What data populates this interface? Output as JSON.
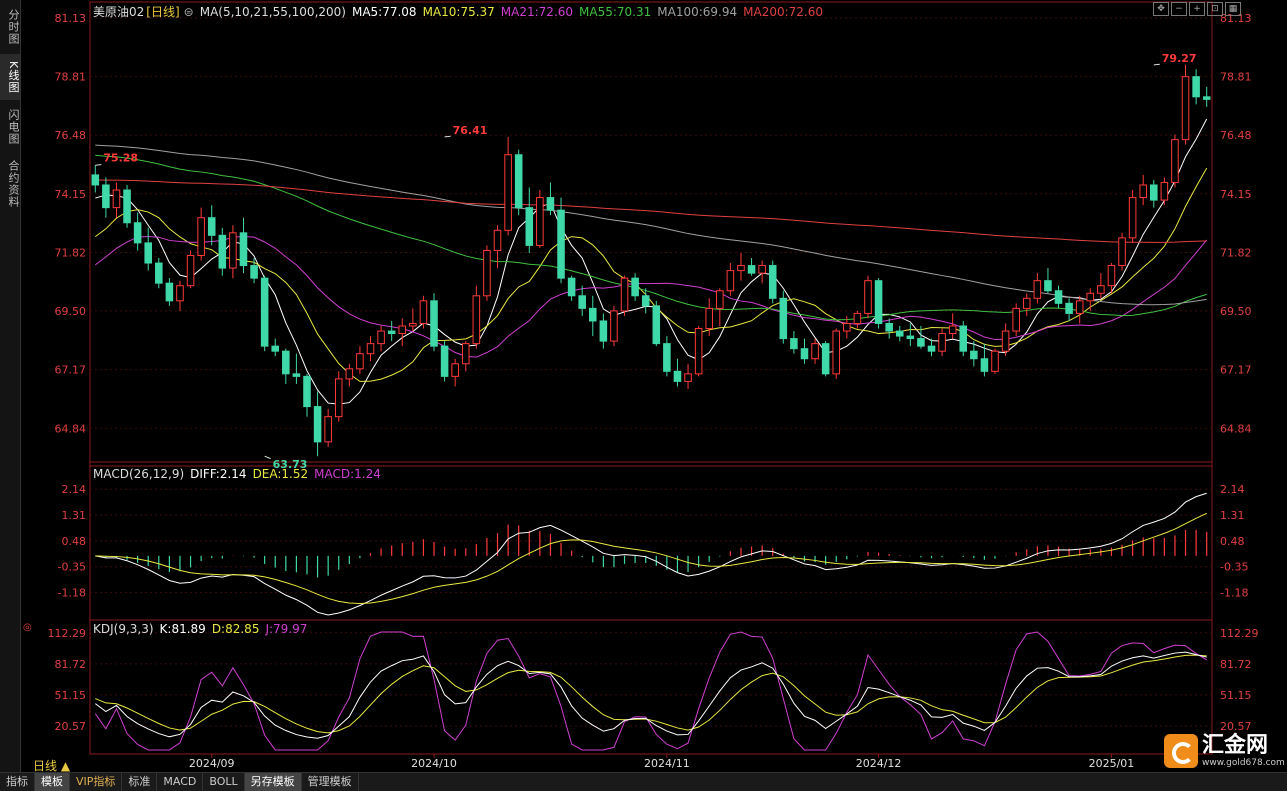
{
  "sidebar": {
    "tabs": [
      "分时图",
      "K线图",
      "闪电图",
      "合约资料"
    ],
    "active": 1
  },
  "header": {
    "symbol": "美原油02",
    "period": "[日线]",
    "ma_label": "MA(5,10,21,55,100,200)",
    "ma": [
      {
        "t": "MA5:77.08",
        "c": "#ffffff"
      },
      {
        "t": "MA10:75.37",
        "c": "#e8e840"
      },
      {
        "t": "MA21:72.60",
        "c": "#d040d0"
      },
      {
        "t": "MA55:70.31",
        "c": "#40c040"
      },
      {
        "t": "MA100:69.94",
        "c": "#a0a0a0"
      },
      {
        "t": "MA200:72.60",
        "c": "#e04040"
      }
    ]
  },
  "macd_header": [
    {
      "t": "MACD(26,12,9)",
      "c": "#dddddd"
    },
    {
      "t": "DIFF:2.14",
      "c": "#ffffff"
    },
    {
      "t": "DEA:1.52",
      "c": "#e8e840"
    },
    {
      "t": "MACD:1.24",
      "c": "#d040d0"
    }
  ],
  "kdj_header": [
    {
      "t": "KDJ(9,3,3)",
      "c": "#dddddd"
    },
    {
      "t": "K:81.89",
      "c": "#ffffff"
    },
    {
      "t": "D:82.85",
      "c": "#e8e840"
    },
    {
      "t": "J:79.97",
      "c": "#d040d0"
    }
  ],
  "price_ticks": [
    "81.13",
    "78.81",
    "76.48",
    "74.15",
    "71.82",
    "69.50",
    "67.17",
    "64.84"
  ],
  "macd_ticks": [
    "2.14",
    "1.31",
    "0.48",
    "-0.35",
    "-1.18"
  ],
  "kdj_ticks": [
    "112.29",
    "81.72",
    "51.15",
    "20.57"
  ],
  "date_labels": [
    {
      "t": "2024/09",
      "i": 11
    },
    {
      "t": "2024/10",
      "i": 32
    },
    {
      "t": "2024/11",
      "i": 54
    },
    {
      "t": "2024/12",
      "i": 74
    },
    {
      "t": "2025/01",
      "i": 96
    }
  ],
  "annotations": {
    "high": "79.27",
    "high_i": 100,
    "high_prev": "76.41",
    "high_prev_i": 33,
    "start": "75.28",
    "start_i": 0,
    "low": "63.73",
    "low_i": 16
  },
  "period_label": "日线",
  "tabs": [
    "指标",
    "模板",
    "VIP指标",
    "标准",
    "MACD",
    "BOLL",
    "另存模板",
    "管理模板"
  ],
  "tab_selected": [
    1,
    6
  ],
  "toolbar_icons": [
    "move-icon",
    "zoom-out-icon",
    "zoom-in-icon",
    "zoom-fit-icon",
    "chart-icon"
  ],
  "logo": {
    "text": "汇金网",
    "url": "www.gold678.com"
  },
  "chart_data": {
    "type": "candlestick",
    "ylim": [
      63.5,
      81.13
    ],
    "ohlc": [
      [
        74.9,
        75.28,
        74.2,
        74.5
      ],
      [
        74.5,
        74.8,
        73.2,
        73.6
      ],
      [
        73.6,
        74.6,
        73.2,
        74.3
      ],
      [
        74.3,
        74.5,
        72.8,
        73.0
      ],
      [
        73.0,
        73.4,
        71.9,
        72.2
      ],
      [
        72.2,
        72.8,
        71.1,
        71.4
      ],
      [
        71.4,
        71.6,
        70.4,
        70.6
      ],
      [
        70.6,
        70.8,
        69.7,
        69.9
      ],
      [
        69.9,
        70.7,
        69.5,
        70.5
      ],
      [
        70.5,
        71.9,
        70.4,
        71.7
      ],
      [
        71.7,
        73.6,
        71.5,
        73.2
      ],
      [
        73.2,
        73.7,
        72.1,
        72.5
      ],
      [
        72.5,
        72.8,
        70.9,
        71.2
      ],
      [
        71.2,
        72.9,
        70.8,
        72.6
      ],
      [
        72.6,
        73.2,
        71.0,
        71.3
      ],
      [
        71.3,
        71.6,
        70.6,
        70.8
      ],
      [
        70.8,
        70.9,
        67.9,
        68.1
      ],
      [
        68.1,
        68.4,
        67.7,
        67.9
      ],
      [
        67.9,
        68.0,
        66.6,
        67.0
      ],
      [
        67.0,
        67.8,
        66.6,
        66.9
      ],
      [
        66.9,
        67.0,
        65.3,
        65.7
      ],
      [
        65.7,
        66.3,
        63.73,
        64.3
      ],
      [
        64.3,
        65.6,
        64.1,
        65.3
      ],
      [
        65.3,
        67.1,
        65.1,
        66.8
      ],
      [
        66.8,
        67.4,
        66.5,
        67.2
      ],
      [
        67.2,
        68.1,
        67.0,
        67.8
      ],
      [
        67.8,
        68.5,
        67.5,
        68.2
      ],
      [
        68.2,
        68.9,
        67.9,
        68.7
      ],
      [
        68.7,
        69.1,
        68.3,
        68.6
      ],
      [
        68.6,
        69.2,
        68.1,
        68.9
      ],
      [
        68.9,
        69.6,
        68.7,
        69.0
      ],
      [
        69.0,
        70.1,
        68.8,
        69.9
      ],
      [
        69.9,
        70.2,
        67.9,
        68.1
      ],
      [
        68.1,
        68.3,
        66.7,
        66.9
      ],
      [
        66.9,
        67.6,
        66.5,
        67.4
      ],
      [
        67.4,
        68.3,
        67.1,
        68.2
      ],
      [
        68.2,
        70.5,
        68.0,
        70.1
      ],
      [
        70.1,
        72.1,
        69.9,
        71.9
      ],
      [
        71.9,
        72.9,
        71.2,
        72.7
      ],
      [
        72.7,
        76.41,
        72.5,
        75.7
      ],
      [
        75.7,
        75.9,
        73.3,
        73.6
      ],
      [
        73.6,
        74.4,
        71.8,
        72.1
      ],
      [
        72.1,
        74.3,
        72.0,
        74.0
      ],
      [
        74.0,
        74.6,
        73.3,
        73.5
      ],
      [
        73.5,
        74.0,
        70.6,
        70.8
      ],
      [
        70.8,
        70.9,
        69.9,
        70.1
      ],
      [
        70.1,
        70.5,
        69.3,
        69.6
      ],
      [
        69.6,
        70.1,
        68.5,
        69.1
      ],
      [
        69.1,
        69.4,
        68.0,
        68.3
      ],
      [
        68.3,
        69.7,
        68.1,
        69.5
      ],
      [
        69.5,
        70.9,
        69.3,
        70.8
      ],
      [
        70.8,
        71.0,
        69.9,
        70.1
      ],
      [
        70.1,
        70.4,
        69.4,
        69.7
      ],
      [
        69.7,
        69.9,
        68.1,
        68.2
      ],
      [
        68.2,
        68.5,
        66.9,
        67.1
      ],
      [
        67.1,
        67.6,
        66.5,
        66.7
      ],
      [
        66.7,
        67.4,
        66.4,
        67.0
      ],
      [
        67.0,
        68.9,
        66.9,
        68.8
      ],
      [
        68.8,
        70.0,
        68.5,
        69.6
      ],
      [
        69.6,
        70.4,
        68.9,
        70.3
      ],
      [
        70.3,
        71.4,
        70.1,
        71.1
      ],
      [
        71.1,
        71.8,
        70.7,
        71.3
      ],
      [
        71.3,
        71.6,
        70.9,
        71.0
      ],
      [
        71.0,
        71.5,
        70.6,
        71.3
      ],
      [
        71.3,
        71.5,
        69.8,
        70.0
      ],
      [
        70.0,
        70.3,
        68.2,
        68.4
      ],
      [
        68.4,
        68.7,
        67.8,
        68.0
      ],
      [
        68.0,
        68.4,
        67.4,
        67.6
      ],
      [
        67.6,
        68.4,
        67.4,
        68.2
      ],
      [
        68.2,
        68.3,
        66.9,
        67.0
      ],
      [
        67.0,
        68.8,
        66.8,
        68.7
      ],
      [
        68.7,
        69.3,
        68.4,
        69.0
      ],
      [
        69.0,
        69.5,
        68.8,
        69.4
      ],
      [
        69.4,
        70.9,
        69.2,
        70.7
      ],
      [
        70.7,
        70.8,
        68.8,
        69.0
      ],
      [
        69.0,
        69.2,
        68.4,
        68.7
      ],
      [
        68.7,
        68.9,
        68.3,
        68.5
      ],
      [
        68.5,
        69.0,
        68.1,
        68.4
      ],
      [
        68.4,
        68.9,
        68.0,
        68.1
      ],
      [
        68.1,
        68.4,
        67.7,
        67.9
      ],
      [
        67.9,
        68.8,
        67.7,
        68.6
      ],
      [
        68.6,
        69.4,
        68.4,
        68.9
      ],
      [
        68.9,
        69.1,
        67.7,
        67.9
      ],
      [
        67.9,
        68.3,
        67.3,
        67.6
      ],
      [
        67.6,
        68.2,
        66.9,
        67.1
      ],
      [
        67.1,
        68.0,
        67.0,
        67.9
      ],
      [
        67.9,
        69.0,
        67.7,
        68.7
      ],
      [
        68.7,
        69.8,
        68.5,
        69.6
      ],
      [
        69.6,
        70.2,
        69.3,
        70.0
      ],
      [
        70.0,
        71.0,
        69.8,
        70.7
      ],
      [
        70.7,
        71.2,
        70.2,
        70.3
      ],
      [
        70.3,
        70.5,
        69.6,
        69.8
      ],
      [
        69.8,
        70.0,
        69.1,
        69.4
      ],
      [
        69.4,
        70.1,
        69.0,
        69.9
      ],
      [
        69.9,
        70.4,
        69.5,
        70.2
      ],
      [
        70.2,
        71.0,
        70.0,
        70.5
      ],
      [
        70.5,
        71.4,
        70.2,
        71.3
      ],
      [
        71.3,
        72.6,
        71.1,
        72.4
      ],
      [
        72.4,
        74.3,
        72.2,
        74.0
      ],
      [
        74.0,
        74.9,
        73.7,
        74.5
      ],
      [
        74.5,
        74.7,
        73.6,
        73.9
      ],
      [
        73.9,
        74.8,
        73.7,
        74.6
      ],
      [
        74.6,
        76.5,
        74.4,
        76.3
      ],
      [
        76.3,
        79.27,
        76.1,
        78.8
      ],
      [
        78.8,
        79.1,
        77.7,
        78.0
      ],
      [
        78.0,
        78.4,
        77.6,
        77.9
      ]
    ],
    "macd_ylim": [
      -1.9,
      2.5
    ],
    "kdj_ylim": [
      -5,
      115
    ]
  }
}
